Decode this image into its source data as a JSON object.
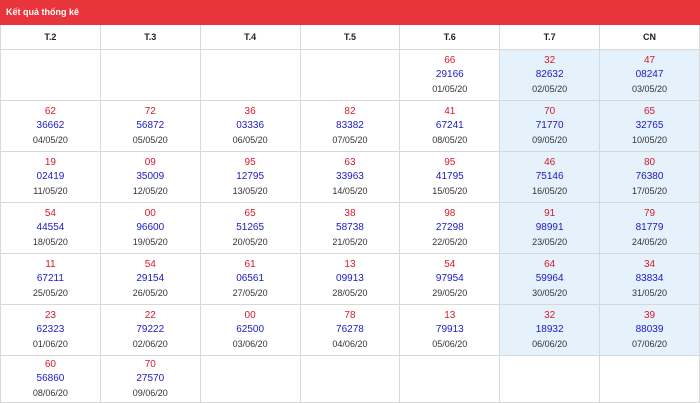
{
  "header": {
    "title": "Kết quả thống kê"
  },
  "columns": [
    "T.2",
    "T.3",
    "T.4",
    "T.5",
    "T.6",
    "T.7",
    "CN"
  ],
  "weeks": [
    [
      null,
      null,
      null,
      null,
      {
        "top": "66",
        "number": "29166",
        "date": "01/05/20"
      },
      {
        "top": "32",
        "number": "82632",
        "date": "02/05/20"
      },
      {
        "top": "47",
        "number": "08247",
        "date": "03/05/20"
      }
    ],
    [
      {
        "top": "62",
        "number": "36662",
        "date": "04/05/20"
      },
      {
        "top": "72",
        "number": "56872",
        "date": "05/05/20"
      },
      {
        "top": "36",
        "number": "03336",
        "date": "06/05/20"
      },
      {
        "top": "82",
        "number": "83382",
        "date": "07/05/20"
      },
      {
        "top": "41",
        "number": "67241",
        "date": "08/05/20"
      },
      {
        "top": "70",
        "number": "71770",
        "date": "09/05/20"
      },
      {
        "top": "65",
        "number": "32765",
        "date": "10/05/20"
      }
    ],
    [
      {
        "top": "19",
        "number": "02419",
        "date": "11/05/20"
      },
      {
        "top": "09",
        "number": "35009",
        "date": "12/05/20"
      },
      {
        "top": "95",
        "number": "12795",
        "date": "13/05/20"
      },
      {
        "top": "63",
        "number": "33963",
        "date": "14/05/20"
      },
      {
        "top": "95",
        "number": "41795",
        "date": "15/05/20"
      },
      {
        "top": "46",
        "number": "75146",
        "date": "16/05/20"
      },
      {
        "top": "80",
        "number": "76380",
        "date": "17/05/20"
      }
    ],
    [
      {
        "top": "54",
        "number": "44554",
        "date": "18/05/20"
      },
      {
        "top": "00",
        "number": "96600",
        "date": "19/05/20"
      },
      {
        "top": "65",
        "number": "51265",
        "date": "20/05/20"
      },
      {
        "top": "38",
        "number": "58738",
        "date": "21/05/20"
      },
      {
        "top": "98",
        "number": "27298",
        "date": "22/05/20"
      },
      {
        "top": "91",
        "number": "98991",
        "date": "23/05/20"
      },
      {
        "top": "79",
        "number": "81779",
        "date": "24/05/20"
      }
    ],
    [
      {
        "top": "11",
        "number": "67211",
        "date": "25/05/20"
      },
      {
        "top": "54",
        "number": "29154",
        "date": "26/05/20"
      },
      {
        "top": "61",
        "number": "06561",
        "date": "27/05/20"
      },
      {
        "top": "13",
        "number": "09913",
        "date": "28/05/20"
      },
      {
        "top": "54",
        "number": "97954",
        "date": "29/05/20"
      },
      {
        "top": "64",
        "number": "59964",
        "date": "30/05/20"
      },
      {
        "top": "34",
        "number": "83834",
        "date": "31/05/20"
      }
    ],
    [
      {
        "top": "23",
        "number": "62323",
        "date": "01/06/20"
      },
      {
        "top": "22",
        "number": "79222",
        "date": "02/06/20"
      },
      {
        "top": "00",
        "number": "62500",
        "date": "03/06/20"
      },
      {
        "top": "78",
        "number": "76278",
        "date": "04/06/20"
      },
      {
        "top": "13",
        "number": "79913",
        "date": "05/06/20"
      },
      {
        "top": "32",
        "number": "18932",
        "date": "06/06/20"
      },
      {
        "top": "39",
        "number": "88039",
        "date": "07/06/20"
      }
    ],
    [
      {
        "top": "60",
        "number": "56860",
        "date": "08/06/20"
      },
      {
        "top": "70",
        "number": "27570",
        "date": "09/06/20"
      },
      null,
      null,
      null,
      null,
      null
    ]
  ],
  "colors": {
    "header": "#e8353b",
    "top_value": "#d5192b",
    "number": "#1a1ac8",
    "weekend_bg": "#e5f1fb"
  }
}
